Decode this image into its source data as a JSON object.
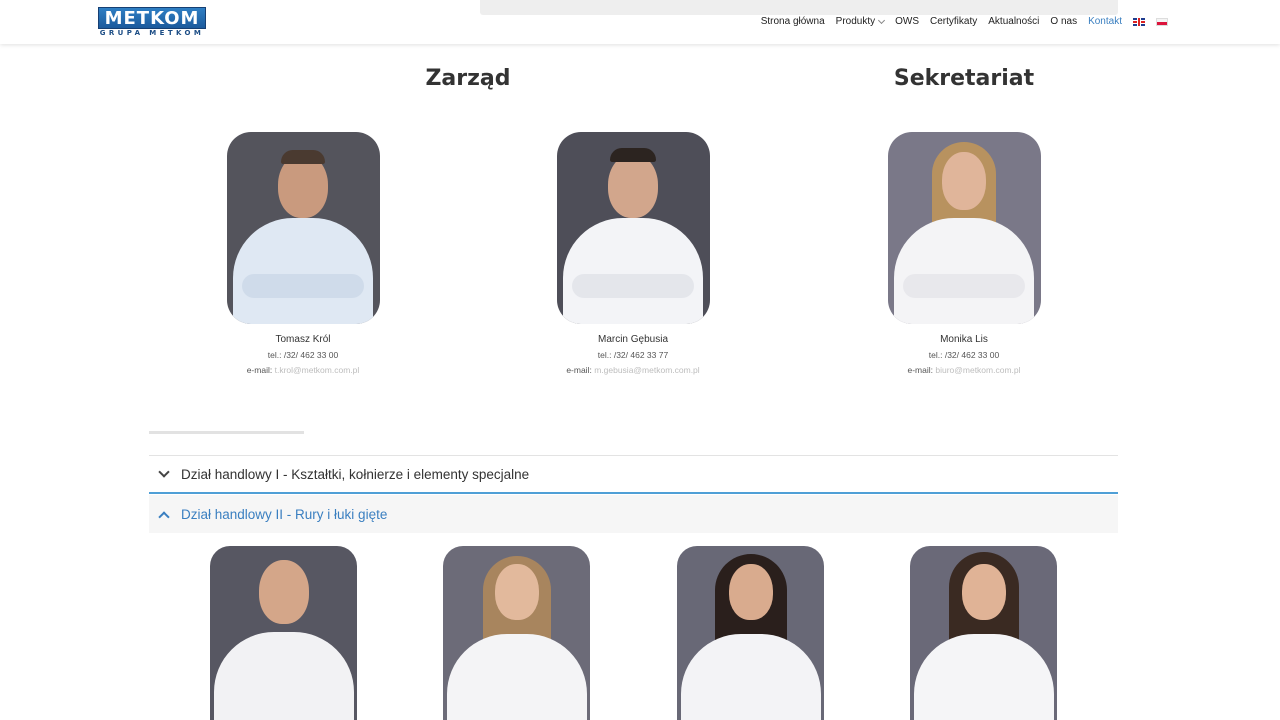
{
  "header": {
    "logo_main": "METKOM",
    "logo_sub": "GRUPA METKOM",
    "nav": [
      {
        "label": "Strona główna"
      },
      {
        "label": "Produkty"
      },
      {
        "label": "OWS"
      },
      {
        "label": "Certyfikaty"
      },
      {
        "label": "Aktualności"
      },
      {
        "label": "O nas"
      },
      {
        "label": "Kontakt"
      }
    ],
    "active": "Kontakt"
  },
  "sections": {
    "zarzad": "Zarząd",
    "sekretariat": "Sekretariat"
  },
  "people": [
    {
      "name": "Tomasz Król",
      "tel": "tel.: /32/ 462 33 00",
      "email_label": "e-mail:",
      "email": "t.krol@metkom.com.pl"
    },
    {
      "name": "Marcin Gębusia",
      "tel": "tel.: /32/ 462 33 77",
      "email_label": "e-mail:",
      "email": "m.gebusia@metkom.com.pl"
    },
    {
      "name": "Monika Lis",
      "tel": "tel.: /32/ 462 33 00",
      "email_label": "e-mail:",
      "email": "biuro@metkom.com.pl"
    }
  ],
  "accordion": [
    {
      "label": "Dział handlowy I - Kształtki, kołnierze i elementy specjalne",
      "state": "collapsed"
    },
    {
      "label": "Dział handlowy II - Rury i łuki gięte",
      "state": "expanded"
    }
  ],
  "colors": {
    "accent": "#3a7fc0",
    "photo_bg": "#5e5e6a"
  }
}
